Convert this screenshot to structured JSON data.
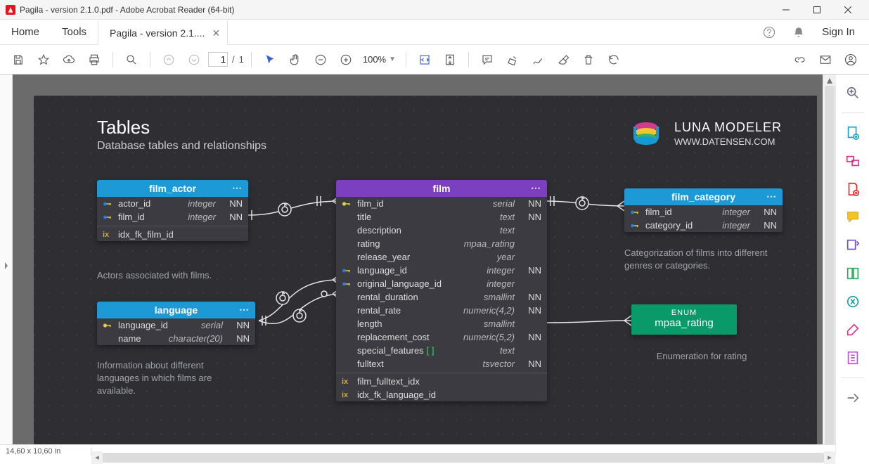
{
  "window": {
    "title": "Pagila - version 2.1.0.pdf - Adobe Acrobat Reader (64-bit)"
  },
  "tabs": {
    "home": "Home",
    "tools": "Tools",
    "doc": "Pagila - version 2.1....",
    "signin": "Sign In"
  },
  "toolbar": {
    "page_current": "1",
    "page_total": "1",
    "zoom": "100%"
  },
  "status": {
    "dims": "14,60 x 10,60 in"
  },
  "diagram": {
    "title": "Tables",
    "subtitle": "Database tables and relationships",
    "brand": {
      "line1": "LUNA MODELER",
      "line2": "WWW.DATENSEN.COM"
    },
    "film_actor": {
      "name": "film_actor",
      "cols": [
        {
          "key": "fk",
          "name": "actor_id",
          "type": "integer",
          "nn": "NN"
        },
        {
          "key": "fk",
          "name": "film_id",
          "type": "integer",
          "nn": "NN"
        }
      ],
      "idx": [
        {
          "name": "idx_fk_film_id"
        }
      ],
      "desc": "Actors associated with films."
    },
    "language": {
      "name": "language",
      "cols": [
        {
          "key": "pk",
          "name": "language_id",
          "type": "serial",
          "nn": "NN"
        },
        {
          "key": "",
          "name": "name",
          "type": "character(20)",
          "nn": "NN"
        }
      ],
      "desc": "Information about different languages in which films are available."
    },
    "film": {
      "name": "film",
      "cols": [
        {
          "key": "pk",
          "name": "film_id",
          "type": "serial",
          "nn": "NN"
        },
        {
          "key": "",
          "name": "title",
          "type": "text",
          "nn": "NN"
        },
        {
          "key": "",
          "name": "description",
          "type": "text",
          "nn": ""
        },
        {
          "key": "",
          "name": "rating",
          "type": "mpaa_rating",
          "nn": ""
        },
        {
          "key": "",
          "name": "release_year",
          "type": "year",
          "nn": ""
        },
        {
          "key": "fk",
          "name": "language_id",
          "type": "integer",
          "nn": "NN"
        },
        {
          "key": "fk",
          "name": "original_language_id",
          "type": "integer",
          "nn": ""
        },
        {
          "key": "",
          "name": "rental_duration",
          "type": "smallint",
          "nn": "NN"
        },
        {
          "key": "",
          "name": "rental_rate",
          "type": "numeric(4,2)",
          "nn": "NN"
        },
        {
          "key": "",
          "name": "length",
          "type": "smallint",
          "nn": ""
        },
        {
          "key": "",
          "name": "replacement_cost",
          "type": "numeric(5,2)",
          "nn": "NN"
        },
        {
          "key": "",
          "name": "special_features",
          "type": "text",
          "nn": "",
          "array": true
        },
        {
          "key": "",
          "name": "fulltext",
          "type": "tsvector",
          "nn": "NN"
        }
      ],
      "idx": [
        {
          "name": "film_fulltext_idx"
        },
        {
          "name": "idx_fk_language_id"
        }
      ]
    },
    "film_category": {
      "name": "film_category",
      "cols": [
        {
          "key": "fk",
          "name": "film_id",
          "type": "integer",
          "nn": "NN"
        },
        {
          "key": "fk",
          "name": "category_id",
          "type": "integer",
          "nn": "NN"
        }
      ],
      "desc": "Categorization of films into different genres or categories."
    },
    "enum": {
      "type_label": "ENUM",
      "name": "mpaa_rating",
      "desc": "Enumeration for rating"
    }
  }
}
